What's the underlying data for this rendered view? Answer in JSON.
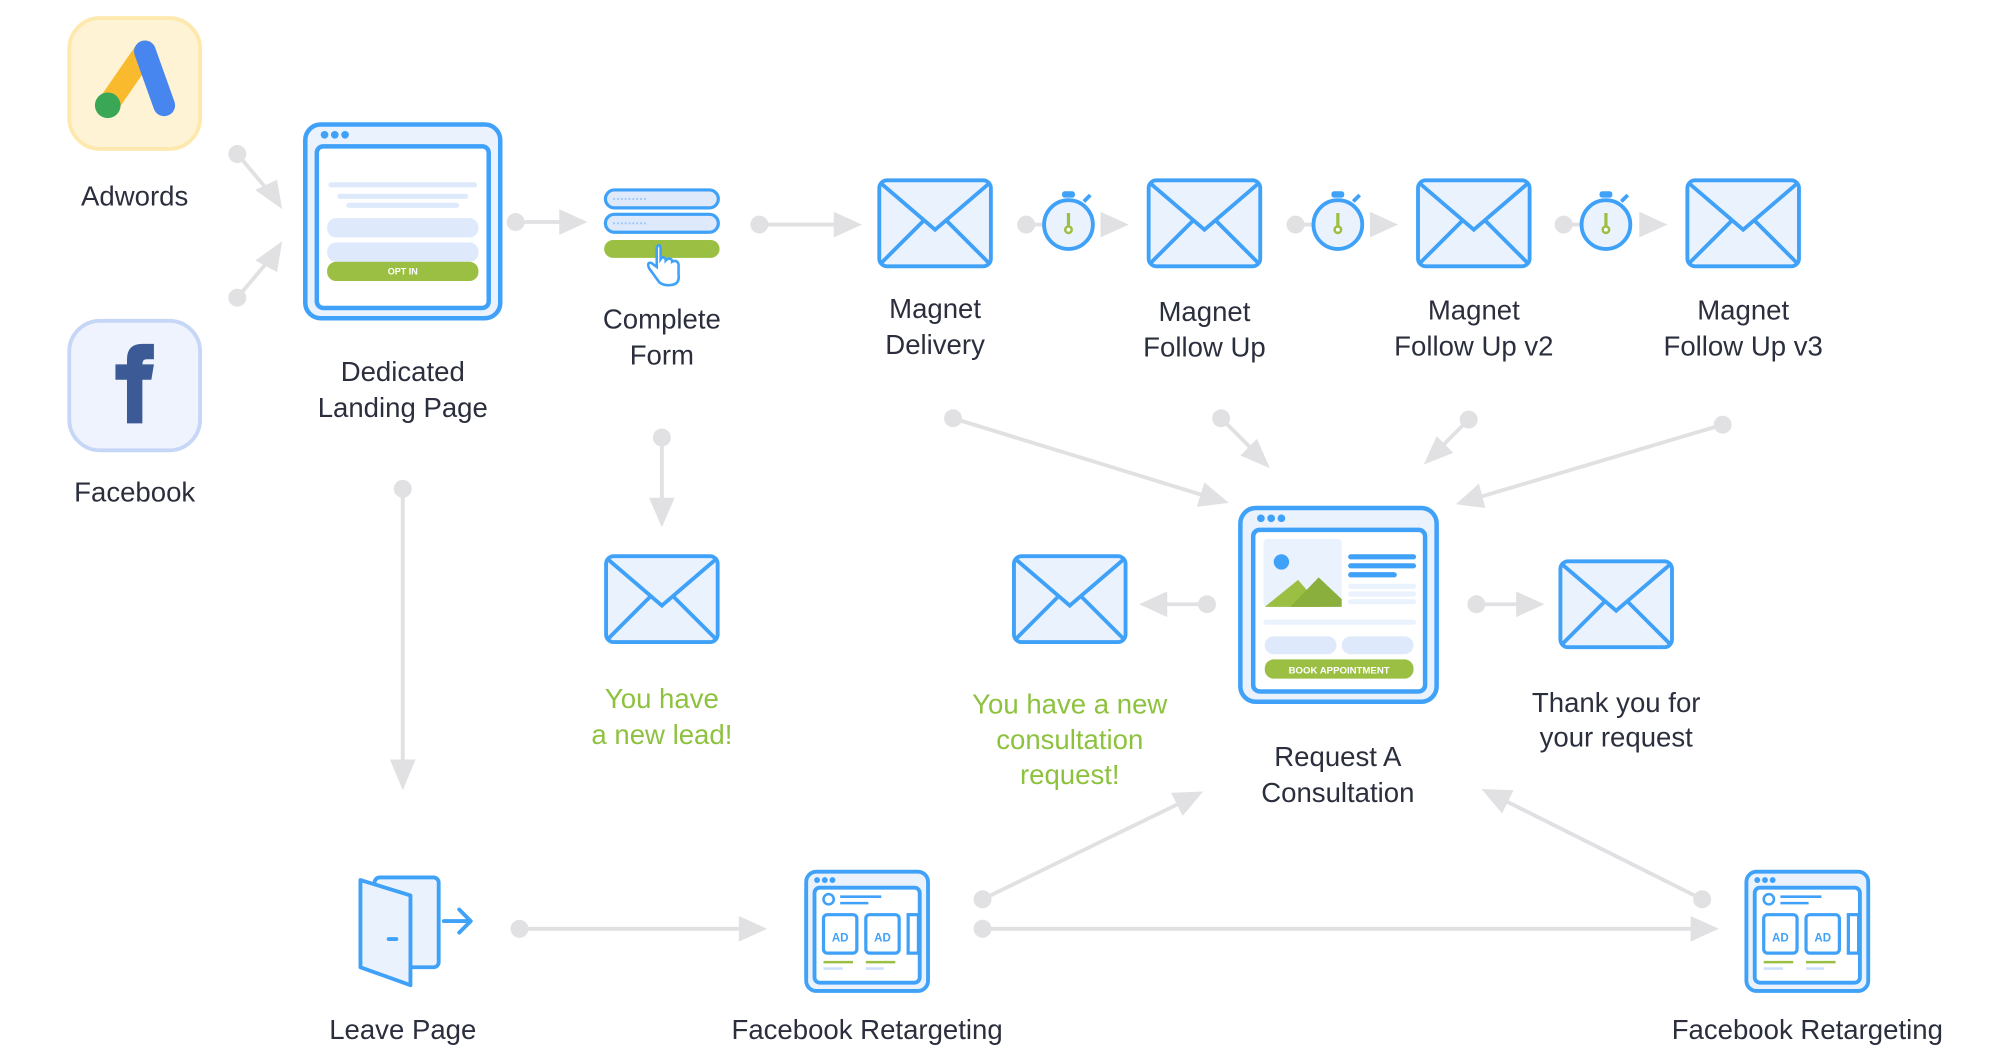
{
  "colors": {
    "accent_blue": "#3fa1f8",
    "green": "#9bbf43",
    "connector": "#e1e1e3",
    "text": "#2b2f3d",
    "highlight_text": "#8dc23f"
  },
  "nodes": {
    "adwords": {
      "label": "Adwords",
      "icon": "google-ads-logo"
    },
    "facebook": {
      "label": "Facebook",
      "icon": "facebook-logo"
    },
    "landing": {
      "lines": [
        "Dedicated",
        "Landing Page"
      ],
      "button": "OPT IN",
      "icon": "browser-page"
    },
    "form": {
      "lines": [
        "Complete",
        "Form"
      ],
      "icon": "form-click"
    },
    "delivery": {
      "lines": [
        "Magnet",
        "Delivery"
      ],
      "icon": "envelope"
    },
    "follow1": {
      "lines": [
        "Magnet",
        "Follow Up"
      ],
      "icon": "envelope"
    },
    "follow2": {
      "lines": [
        "Magnet",
        "Follow Up v2"
      ],
      "icon": "envelope"
    },
    "follow3": {
      "lines": [
        "Magnet",
        "Follow Up v3"
      ],
      "icon": "envelope"
    },
    "lead": {
      "lines": [
        "You have",
        "a new lead!"
      ],
      "icon": "envelope"
    },
    "consult_notice": {
      "lines": [
        "You have a new",
        "consultation",
        "request!"
      ],
      "icon": "envelope"
    },
    "consultation": {
      "lines": [
        "Request A",
        "Consultation"
      ],
      "button": "BOOK APPOINTMENT",
      "icon": "browser-page"
    },
    "thanks": {
      "lines": [
        "Thank you for",
        "your request"
      ],
      "icon": "envelope"
    },
    "leave": {
      "label": "Leave Page",
      "icon": "door-exit"
    },
    "retarget1": {
      "label": "Facebook Retargeting",
      "ad": "AD",
      "icon": "ad-page"
    },
    "retarget2": {
      "label": "Facebook Retargeting",
      "ad": "AD",
      "icon": "ad-page"
    }
  },
  "delays": {
    "icon": "stopwatch"
  }
}
